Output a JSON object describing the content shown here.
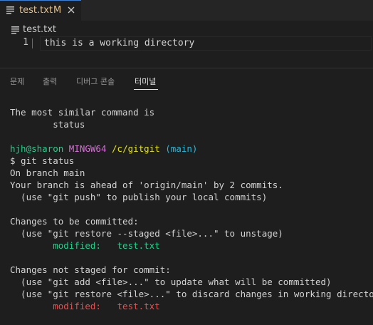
{
  "tab": {
    "label": "test.txt",
    "badge": "M",
    "file_icon": "lines-file-icon",
    "close_icon": "close-icon"
  },
  "breadcrumb": {
    "label": "test.txt",
    "icon": "lines-file-icon"
  },
  "editor": {
    "line_number": "1",
    "text": "this is a working directory"
  },
  "panel": {
    "tabs": [
      {
        "label": "문제",
        "active": false
      },
      {
        "label": "출력",
        "active": false
      },
      {
        "label": "디버그 콘솔",
        "active": false
      },
      {
        "label": "터미널",
        "active": true
      }
    ]
  },
  "terminal": {
    "suggest_heading": "The most similar command is",
    "suggest_command": "        status",
    "prompt": {
      "user_host": "hjh@sharon",
      "env": "MINGW64",
      "path": "/c/gitgit",
      "branch": "(main)"
    },
    "command": "$ git status",
    "lines_status": [
      "On branch main",
      "Your branch is ahead of 'origin/main' by 2 commits.",
      "  (use \"git push\" to publish your local commits)"
    ],
    "staged_heading": "Changes to be committed:",
    "staged_hint": "  (use \"git restore --staged <file>...\" to unstage)",
    "staged_entry": "        modified:   test.txt",
    "unstaged_heading": "Changes not staged for commit:",
    "unstaged_hint_1": "  (use \"git add <file>...\" to update what will be committed)",
    "unstaged_hint_2": "  (use \"git restore <file>...\" to discard changes in working directory)",
    "unstaged_entry": "        modified:   test.txt"
  },
  "colors": {
    "modified_tab": "#e2c08d",
    "prompt_user": "#23d18b",
    "prompt_env": "#d670d6",
    "prompt_path": "#e5e510",
    "prompt_branch": "#29b8db",
    "staged": "#23d18b",
    "unstaged": "#f14c4c"
  }
}
